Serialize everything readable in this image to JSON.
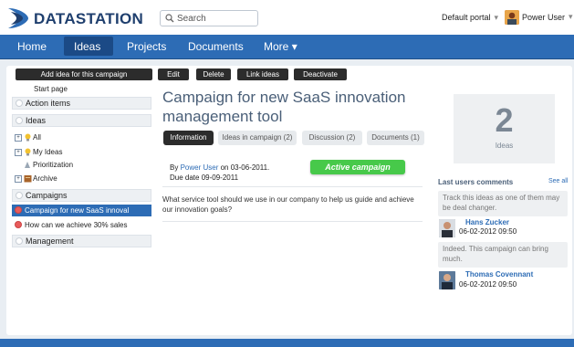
{
  "brand": {
    "name": "DATASTATION"
  },
  "search": {
    "placeholder": "Search"
  },
  "header": {
    "portal_label": "Default portal",
    "user_name": "Power User"
  },
  "nav": {
    "items": [
      "Home",
      "Ideas",
      "Projects",
      "Documents",
      "More"
    ],
    "active": "Ideas"
  },
  "toolbar": {
    "add_idea": "Add idea for this campaign",
    "edit": "Edit",
    "delete": "Delete",
    "link_ideas": "Link ideas",
    "deactivate": "Deactivate"
  },
  "sidebar": {
    "start_page": "Start page",
    "action_items": "Action items",
    "ideas": "Ideas",
    "ideas_items": [
      "All",
      "My Ideas",
      "Prioritization",
      "Archive"
    ],
    "campaigns": "Campaigns",
    "campaign_items": [
      "Campaign for new SaaS innoval",
      "How can we achieve 30% sales"
    ],
    "management": "Management"
  },
  "campaign": {
    "title": "Campaign for new SaaS innovation management tool",
    "tabs": [
      "Information",
      "Ideas in campaign (2)",
      "Discussion (2)",
      "Documents (1)"
    ],
    "by_prefix": "By",
    "author": "Power User",
    "created": "on 03-06-2011.",
    "due": "Due date 09-09-2011",
    "status": "Active campaign",
    "description": "What service tool should we use in our company to help us guide and achieve our innovation goals?"
  },
  "stats": {
    "ideas_count": "2",
    "ideas_label": "Ideas"
  },
  "comments": {
    "heading": "Last users comments",
    "see_all": "See all",
    "items": [
      {
        "text": "Track this ideas as one of them may be deal changer.",
        "author": "Hans Zucker",
        "date": "06-02-2012 09:50"
      },
      {
        "text": "Indeed. This campaign can bring much.",
        "author": "Thomas Covennant",
        "date": "06-02-2012 09:50"
      }
    ]
  },
  "colors": {
    "nav_blue": "#2d6cb5",
    "active_green": "#47c94a",
    "dark_button": "#2c2c2c"
  }
}
